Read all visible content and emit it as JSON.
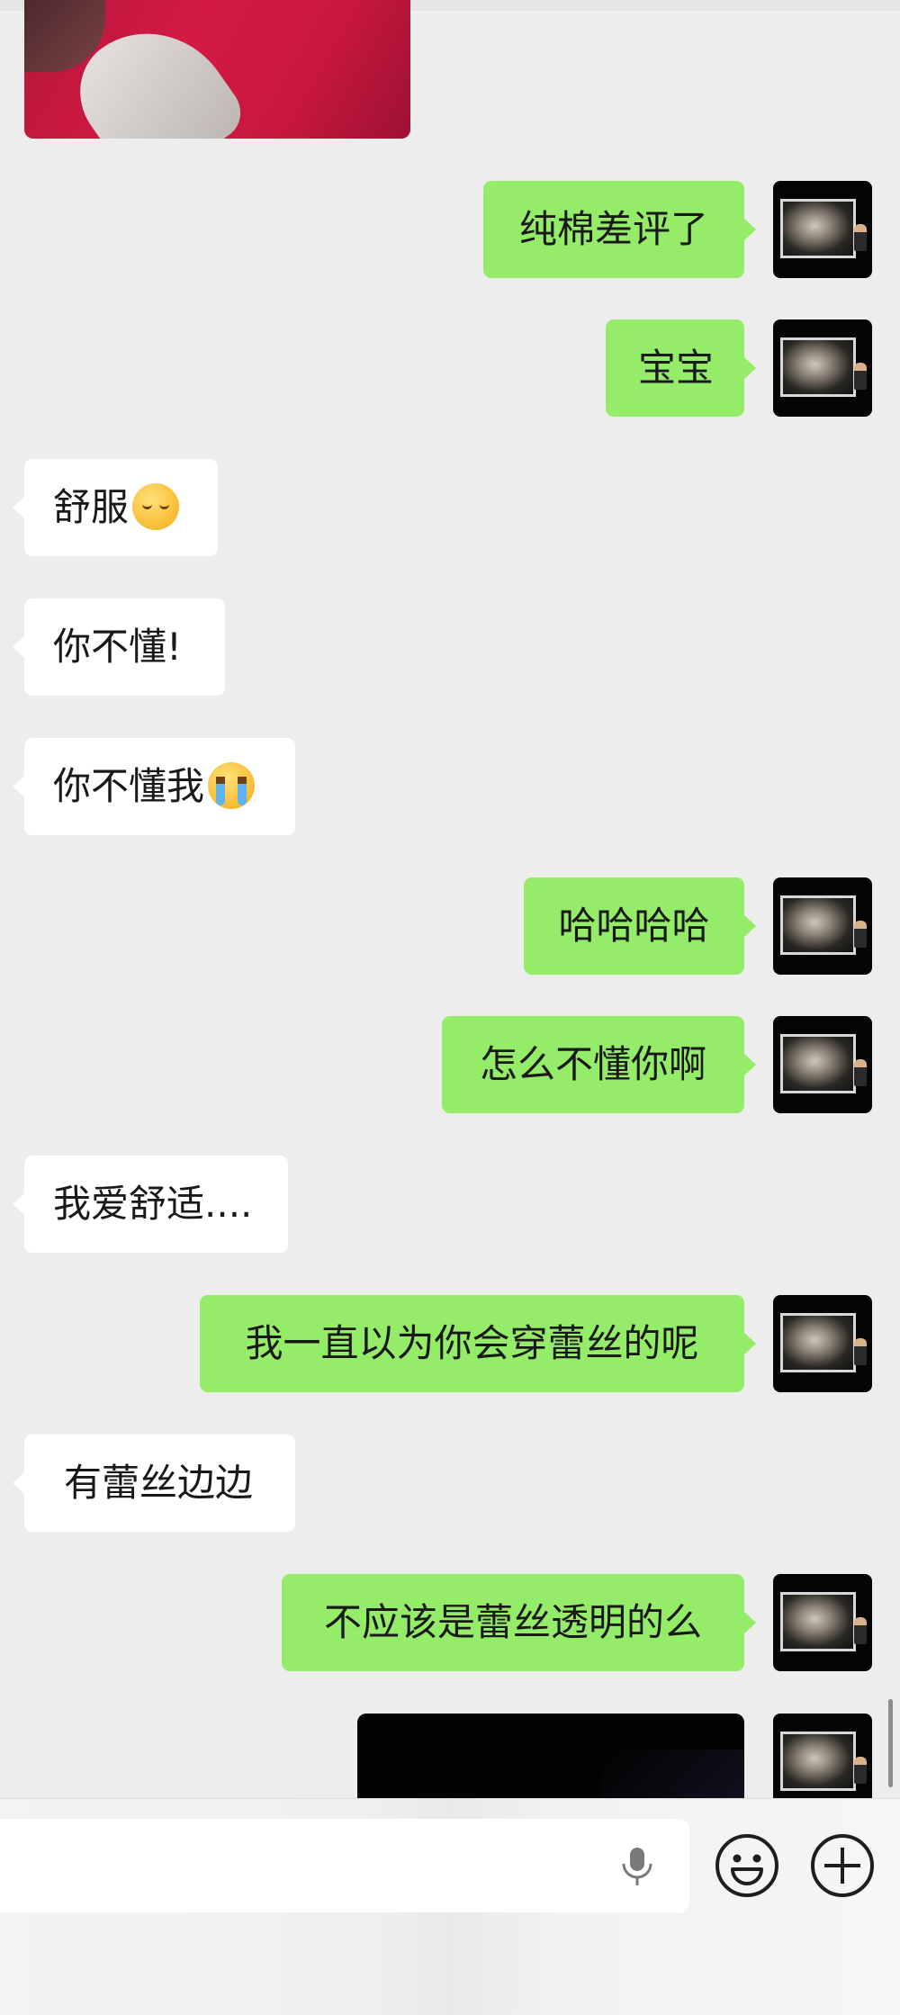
{
  "messages": [
    {
      "side": "right",
      "text": "纯棉差评了"
    },
    {
      "side": "right",
      "text": "宝宝"
    },
    {
      "side": "left",
      "text": "舒服",
      "emoji": "relieved-face-emoji"
    },
    {
      "side": "left",
      "text": "你不懂!"
    },
    {
      "side": "left",
      "text": "你不懂我",
      "emoji": "crying-face-emoji"
    },
    {
      "side": "right",
      "text": "哈哈哈哈"
    },
    {
      "side": "right",
      "text": "怎么不懂你啊"
    },
    {
      "side": "left",
      "text": "我爱舒适...."
    },
    {
      "side": "right",
      "text": "我一直以为你会穿蕾丝的呢"
    },
    {
      "side": "left",
      "text": "有蕾丝边边"
    },
    {
      "side": "right",
      "text": "不应该是蕾丝透明的么"
    }
  ],
  "input_bar": {
    "text_value": "",
    "icons": [
      "microphone-icon",
      "emoji-icon",
      "plus-icon"
    ]
  },
  "colors": {
    "chat_background": "#ededed",
    "sent_bubble": "#95ec69",
    "received_bubble": "#ffffff",
    "text": "#191919"
  }
}
